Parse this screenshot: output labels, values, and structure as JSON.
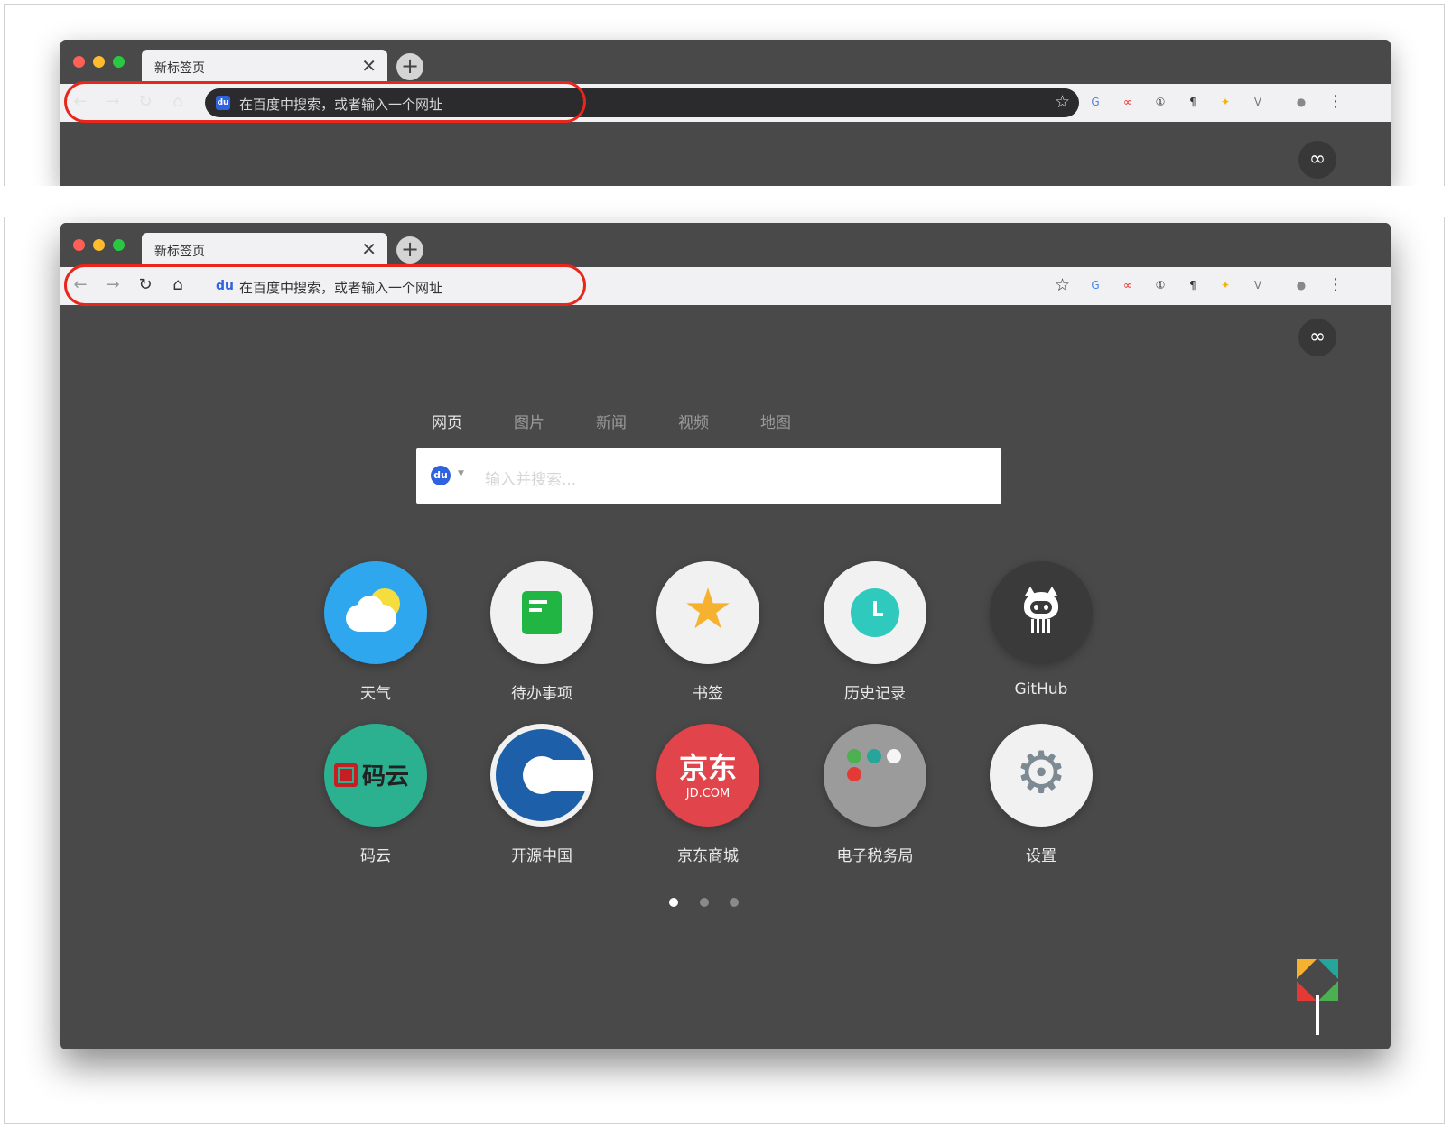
{
  "browser": {
    "tab_title": "新标签页",
    "tab_close": "✕",
    "new_tab": "+",
    "address_placeholder": "在百度中搜索，或者输入一个网址",
    "baidu_icon": "du",
    "nav": {
      "back": "←",
      "forward": "→",
      "reload": "↻",
      "home": "⌂"
    },
    "star": "☆",
    "menu": "⋮",
    "extensions": [
      {
        "icon": "google-translate-icon",
        "glyph": "G",
        "color": "#4a86e8"
      },
      {
        "icon": "infinity-extension-icon",
        "glyph": "∞",
        "color": "#e8261c"
      },
      {
        "icon": "onepassword-icon",
        "glyph": "①",
        "color": "#333333"
      },
      {
        "icon": "pilcrow-icon",
        "glyph": "¶",
        "color": "#333333"
      },
      {
        "icon": "colorful-square-icon",
        "glyph": "✦",
        "color": "#f4b400"
      },
      {
        "icon": "vue-devtools-icon",
        "glyph": "V",
        "color": "#777777"
      },
      {
        "icon": "profile-avatar-icon",
        "glyph": "●",
        "color": "#888888"
      }
    ]
  },
  "page": {
    "infinity_button": "∞",
    "search_tabs": [
      "网页",
      "图片",
      "新闻",
      "视频",
      "地图"
    ],
    "active_search_tab": 0,
    "search_engine_icon": "du",
    "search_placeholder": "输入并搜索...",
    "tiles": [
      {
        "label": "天气",
        "icon": "weather-icon"
      },
      {
        "label": "待办事项",
        "icon": "todo-icon"
      },
      {
        "label": "书签",
        "icon": "bookmark-star-icon"
      },
      {
        "label": "历史记录",
        "icon": "history-clock-icon"
      },
      {
        "label": "GitHub",
        "icon": "github-octocat-icon"
      },
      {
        "label": "码云",
        "icon": "gitee-icon",
        "logo_text": "码云"
      },
      {
        "label": "开源中国",
        "icon": "oschina-icon"
      },
      {
        "label": "京东商城",
        "icon": "jd-icon",
        "logo_text": "京东",
        "logo_subtext": "JD.COM"
      },
      {
        "label": "电子税务局",
        "icon": "tax-folder-icon"
      },
      {
        "label": "设置",
        "icon": "settings-gear-icon"
      }
    ],
    "pagination": {
      "count": 3,
      "active": 0
    }
  }
}
